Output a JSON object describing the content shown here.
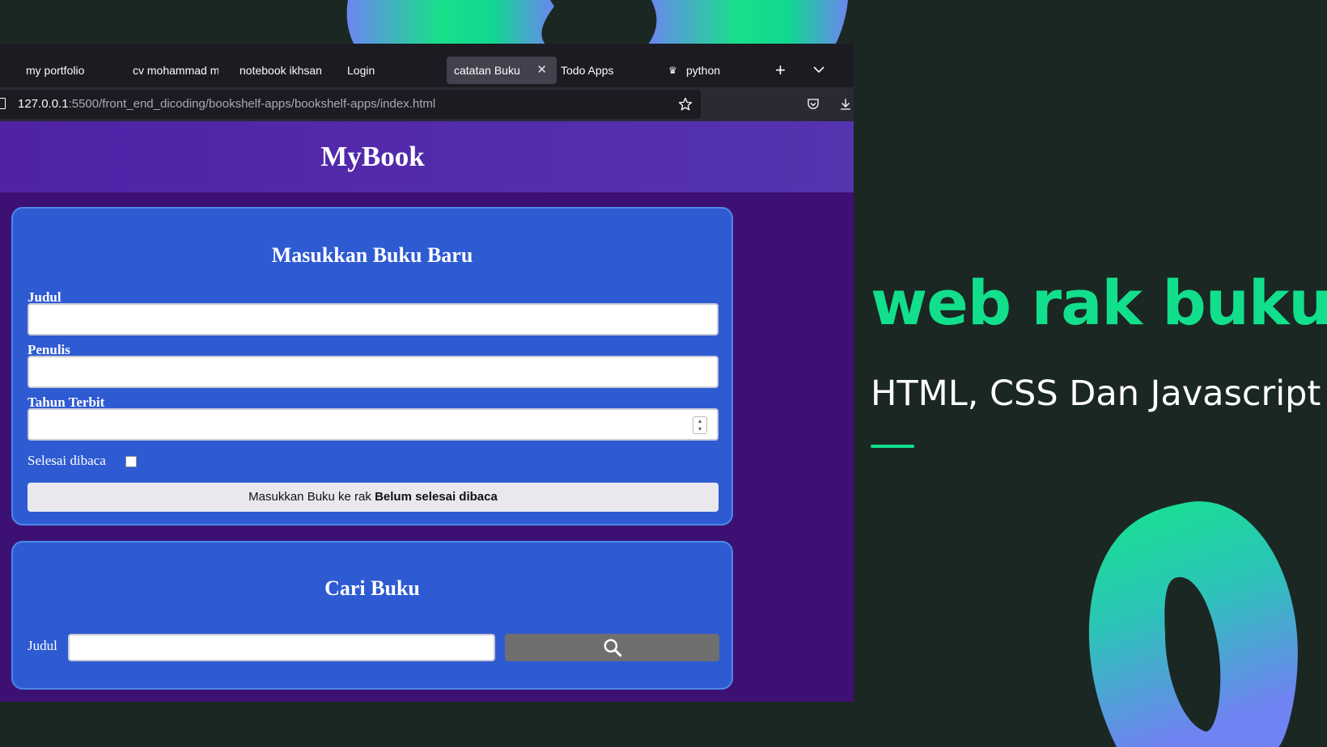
{
  "tabs": [
    {
      "label": "my portfolio"
    },
    {
      "label": "cv mohammad m"
    },
    {
      "label": "notebook ikhsan"
    },
    {
      "label": "Login"
    },
    {
      "label": "catatan Buku",
      "active": true
    },
    {
      "label": "Todo Apps"
    },
    {
      "label": "python"
    }
  ],
  "url": {
    "host": "127.0.0.1",
    "path": ":5500/front_end_dicoding/bookshelf-apps/bookshelf-apps/index.html"
  },
  "app": {
    "title": "MyBook"
  },
  "form": {
    "heading": "Masukkan Buku Baru",
    "title_label": "Judul",
    "author_label": "Penulis",
    "year_label": "Tahun Terbit",
    "finished_label": "Selesai dibaca",
    "submit_prefix": "Masukkan Buku ke rak",
    "submit_bold": "Belum selesai dibaca"
  },
  "search": {
    "heading": "Cari Buku",
    "label": "Judul"
  },
  "hero": {
    "title": "web rak buku",
    "subtitle": "HTML, CSS Dan Javascript"
  },
  "colors": {
    "background": "#1b2723",
    "accent": "#12df8c",
    "page_bg": "#3d1074",
    "header_bg": "#5534b0",
    "card_bg": "#2e5bd2"
  },
  "icons": [
    "plus-icon",
    "chevron-down-icon",
    "page-icon",
    "star-icon",
    "pocket-icon",
    "download-icon",
    "search-icon",
    "crown-icon",
    "close-icon"
  ]
}
